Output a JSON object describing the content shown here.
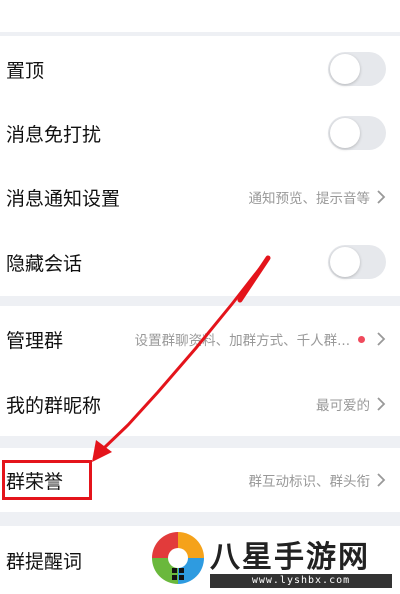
{
  "settings": {
    "pin": {
      "label": "置顶",
      "toggle_on": false
    },
    "mute": {
      "label": "消息免打扰",
      "toggle_on": false
    },
    "notify": {
      "label": "消息通知设置",
      "value": "通知预览、提示音等"
    },
    "hide": {
      "label": "隐藏会话",
      "toggle_on": false
    },
    "manage": {
      "label": "管理群",
      "value": "设置群聊资料、加群方式、千人群..."
    },
    "nickname": {
      "label": "我的群昵称",
      "value": "最可爱的"
    },
    "honor": {
      "label": "群荣誉",
      "value": "群互动标识、群头衔"
    },
    "reminder": {
      "label": "群提醒词"
    }
  },
  "watermark": {
    "text": "八星手游网",
    "url": "www.lyshbx.com"
  },
  "colors": {
    "background": "#eef0f4",
    "row": "#ffffff",
    "secondary_text": "#999999",
    "toggle_off": "#e6e8ec",
    "badge_dot": "#f04a5c",
    "annotation_red": "#e4141b"
  }
}
